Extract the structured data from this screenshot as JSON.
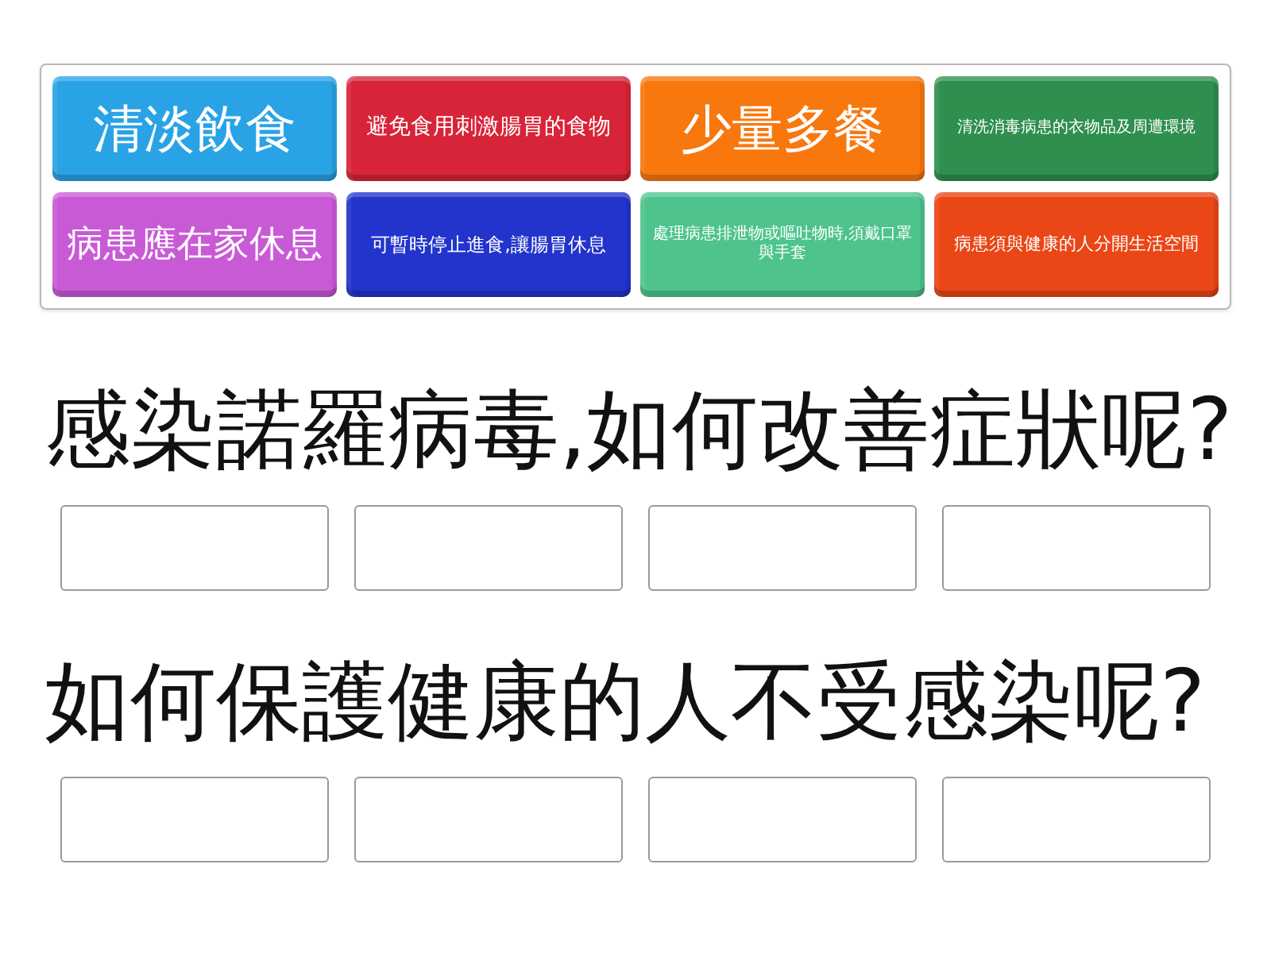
{
  "tiles": [
    {
      "text": "清淡飲食",
      "color": "#2aa3e6"
    },
    {
      "text": "避免食用刺激腸胃的食物",
      "color": "#d82438"
    },
    {
      "text": "少量多餐",
      "color": "#f8780e"
    },
    {
      "text": "清洗消毒病患的衣物品及周遭環境",
      "color": "#2f8f4f"
    },
    {
      "text": "病患應在家休息",
      "color": "#c95ad6"
    },
    {
      "text": "可暫時停止進食,讓腸胃休息",
      "color": "#2234cc"
    },
    {
      "text": "處理病患排泄物或嘔吐物時,須戴口罩與手套",
      "color": "#4ec48c"
    },
    {
      "text": "病患須與健康的人分開生活空間",
      "color": "#ea4616"
    }
  ],
  "questions": [
    {
      "text": "感染諾羅病毒,如何改善症狀呢?",
      "slots": [
        {
          "kind": "blank"
        },
        {
          "kind": "blank"
        },
        {
          "kind": "blank"
        },
        {
          "kind": "blank"
        }
      ]
    },
    {
      "text": "如何保護健康的人不受感染呢?",
      "slots": [
        {
          "kind": "blank"
        },
        {
          "kind": "blank"
        },
        {
          "kind": "blank"
        },
        {
          "kind": "blank"
        }
      ]
    }
  ]
}
